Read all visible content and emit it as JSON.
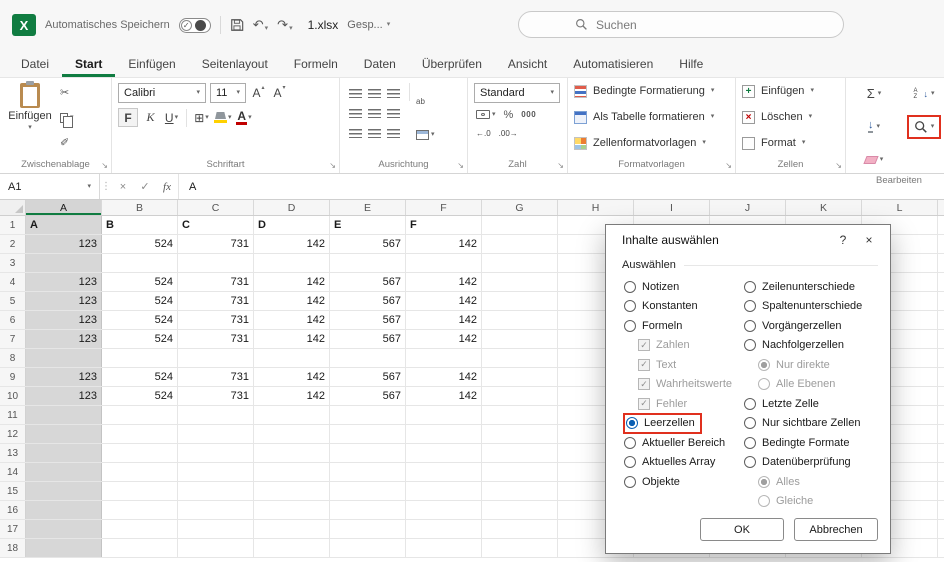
{
  "titlebar": {
    "autosave_label": "Automatisches Speichern",
    "filename": "1.xlsx",
    "saved_status": "Gesp...",
    "search_placeholder": "Suchen"
  },
  "tabs": {
    "items": [
      "Datei",
      "Start",
      "Einfügen",
      "Seitenlayout",
      "Formeln",
      "Daten",
      "Überprüfen",
      "Ansicht",
      "Automatisieren",
      "Hilfe"
    ],
    "active": "Start"
  },
  "ribbon": {
    "clipboard": {
      "paste": "Einfügen",
      "group": "Zwischenablage"
    },
    "font": {
      "name": "Calibri",
      "size": "11",
      "bold": "F",
      "italic": "K",
      "underline": "U",
      "group": "Schriftart"
    },
    "alignment": {
      "group": "Ausrichtung"
    },
    "number": {
      "format": "Standard",
      "percent": "%",
      "thousands": "000",
      "group": "Zahl"
    },
    "styles": {
      "conditional": "Bedingte Formatierung",
      "table": "Als Tabelle formatieren",
      "cell_styles": "Zellenformatvorlagen",
      "group": "Formatvorlagen"
    },
    "cells": {
      "insert": "Einfügen",
      "delete": "Löschen",
      "format": "Format",
      "group": "Zellen"
    },
    "editing": {
      "group": "Bearbeiten"
    }
  },
  "formula_bar": {
    "cell_ref": "A1",
    "content": "A"
  },
  "grid": {
    "column_headers": [
      "A",
      "B",
      "C",
      "D",
      "E",
      "F",
      "G",
      "H",
      "I",
      "J",
      "K",
      "L"
    ],
    "selected_column": "A",
    "rows": [
      {
        "n": 1,
        "header_row": true,
        "cells": [
          "A",
          "B",
          "C",
          "D",
          "E",
          "F"
        ]
      },
      {
        "n": 2,
        "cells": [
          "123",
          "524",
          "731",
          "142",
          "567",
          "142"
        ]
      },
      {
        "n": 3,
        "cells": []
      },
      {
        "n": 4,
        "cells": [
          "123",
          "524",
          "731",
          "142",
          "567",
          "142"
        ]
      },
      {
        "n": 5,
        "cells": [
          "123",
          "524",
          "731",
          "142",
          "567",
          "142"
        ]
      },
      {
        "n": 6,
        "cells": [
          "123",
          "524",
          "731",
          "142",
          "567",
          "142"
        ]
      },
      {
        "n": 7,
        "cells": [
          "123",
          "524",
          "731",
          "142",
          "567",
          "142"
        ]
      },
      {
        "n": 8,
        "cells": []
      },
      {
        "n": 9,
        "cells": [
          "123",
          "524",
          "731",
          "142",
          "567",
          "142"
        ]
      },
      {
        "n": 10,
        "cells": [
          "123",
          "524",
          "731",
          "142",
          "567",
          "142"
        ]
      },
      {
        "n": 11,
        "cells": []
      },
      {
        "n": 12,
        "cells": []
      },
      {
        "n": 13,
        "cells": []
      },
      {
        "n": 14,
        "cells": []
      },
      {
        "n": 15,
        "cells": []
      },
      {
        "n": 16,
        "cells": []
      },
      {
        "n": 17,
        "cells": []
      },
      {
        "n": 18,
        "cells": []
      }
    ]
  },
  "dialog": {
    "title": "Inhalte auswählen",
    "help_icon": "?",
    "close_icon": "×",
    "section_label": "Auswählen",
    "left_options": [
      {
        "label": "Notizen",
        "type": "radio",
        "checked": false
      },
      {
        "label": "Konstanten",
        "type": "radio",
        "checked": false
      },
      {
        "label": "Formeln",
        "type": "radio",
        "checked": false
      },
      {
        "label": "Zahlen",
        "type": "checkbox",
        "checked": true,
        "disabled": true,
        "indent": 1
      },
      {
        "label": "Text",
        "type": "checkbox",
        "checked": true,
        "disabled": true,
        "indent": 1
      },
      {
        "label": "Wahrheitswerte",
        "type": "checkbox",
        "checked": true,
        "disabled": true,
        "indent": 1
      },
      {
        "label": "Fehler",
        "type": "checkbox",
        "checked": true,
        "disabled": true,
        "indent": 1
      },
      {
        "label": "Leerzellen",
        "type": "radio",
        "checked": true,
        "highlight": true
      },
      {
        "label": "Aktueller Bereich",
        "type": "radio",
        "checked": false
      },
      {
        "label": "Aktuelles Array",
        "type": "radio",
        "checked": false
      },
      {
        "label": "Objekte",
        "type": "radio",
        "checked": false
      }
    ],
    "right_options": [
      {
        "label": "Zeilenunterschiede",
        "type": "radio",
        "checked": false
      },
      {
        "label": "Spaltenunterschiede",
        "type": "radio",
        "checked": false
      },
      {
        "label": "Vorgängerzellen",
        "type": "radio",
        "checked": false
      },
      {
        "label": "Nachfolgerzellen",
        "type": "radio",
        "checked": false
      },
      {
        "label": "Nur direkte",
        "type": "radio",
        "checked": true,
        "disabled": true,
        "indent": 1
      },
      {
        "label": "Alle Ebenen",
        "type": "radio",
        "checked": false,
        "disabled": true,
        "indent": 1
      },
      {
        "label": "Letzte Zelle",
        "type": "radio",
        "checked": false
      },
      {
        "label": "Nur sichtbare Zellen",
        "type": "radio",
        "checked": false
      },
      {
        "label": "Bedingte Formate",
        "type": "radio",
        "checked": false
      },
      {
        "label": "Datenüberprüfung",
        "type": "radio",
        "checked": false
      },
      {
        "label": "Alles",
        "type": "radio",
        "checked": true,
        "disabled": true,
        "indent": 1
      },
      {
        "label": "Gleiche",
        "type": "radio",
        "checked": false,
        "disabled": true,
        "indent": 1
      }
    ],
    "ok_label": "OK",
    "cancel_label": "Abbrechen"
  },
  "icons": {
    "excel_x": "X",
    "check": "✓",
    "close": "×",
    "caret": "▾",
    "launcher": "↘",
    "cut": "✂",
    "format_painter": "✐",
    "undo": "↶",
    "redo": "↷",
    "letter_a": "A",
    "tri_up": "▴",
    "tri_down": "▾",
    "borders": "⊞",
    "wrap_ab": "ab",
    "sigma": "Σ",
    "sort_letters": "AZ",
    "arrow_down": "↓",
    "dec_inc": "←.0",
    "dec_dec": ".00→",
    "menu_dots": "⋮",
    "fx": "fx"
  },
  "colors": {
    "excel_green": "#107C41",
    "selection_gray": "#d7d7d7",
    "highlight_red": "#e0301e",
    "radio_blue": "#0b5fb3"
  }
}
